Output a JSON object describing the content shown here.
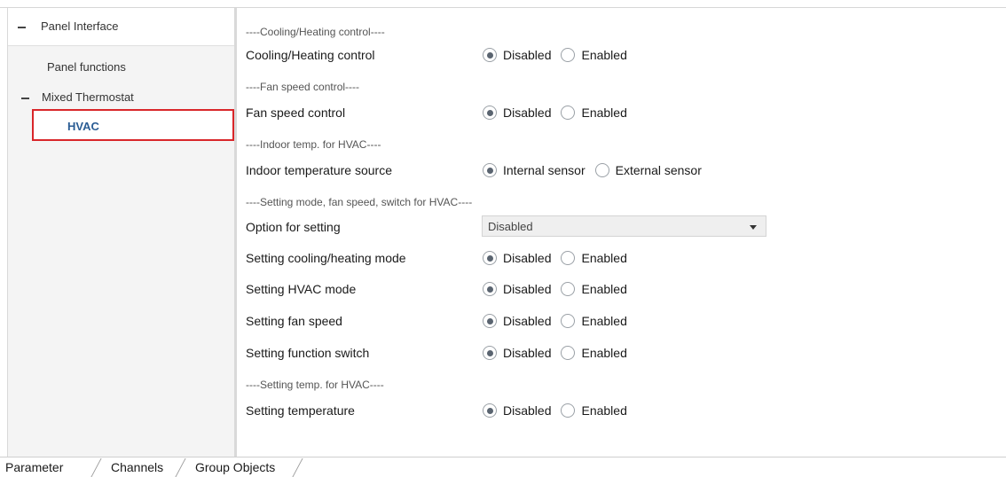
{
  "tree": {
    "root": {
      "label": "Panel Interface",
      "expanded": true
    },
    "items": [
      {
        "label": "Panel functions"
      },
      {
        "label": "Mixed Thermostat",
        "expanded": true
      },
      {
        "label": "HVAC",
        "selected": true
      }
    ]
  },
  "main": {
    "sections": {
      "cooling_heating": "----Cooling/Heating control----",
      "fan_speed": "----Fan speed control----",
      "indoor_temp": "----Indoor temp. for HVAC----",
      "setting_mode": "----Setting mode, fan speed, switch for HVAC----",
      "setting_temp": "----Setting temp. for HVAC----"
    },
    "params": {
      "cooling_heating_control": {
        "label": "Cooling/Heating control",
        "option1": "Disabled",
        "option2": "Enabled",
        "selected": "Disabled"
      },
      "fan_speed_control": {
        "label": "Fan speed control",
        "option1": "Disabled",
        "option2": "Enabled",
        "selected": "Disabled"
      },
      "indoor_temperature_source": {
        "label": "Indoor temperature source",
        "option1": "Internal sensor",
        "option2": "External sensor",
        "selected": "Internal sensor"
      },
      "option_for_setting": {
        "label": "Option for setting",
        "value": "Disabled"
      },
      "setting_cooling_heating_mode": {
        "label": "Setting cooling/heating mode",
        "option1": "Disabled",
        "option2": "Enabled",
        "selected": "Disabled"
      },
      "setting_hvac_mode": {
        "label": "Setting HVAC mode",
        "option1": "Disabled",
        "option2": "Enabled",
        "selected": "Disabled"
      },
      "setting_fan_speed": {
        "label": "Setting fan speed",
        "option1": "Disabled",
        "option2": "Enabled",
        "selected": "Disabled"
      },
      "setting_function_switch": {
        "label": "Setting function switch",
        "option1": "Disabled",
        "option2": "Enabled",
        "selected": "Disabled"
      },
      "setting_temperature": {
        "label": "Setting temperature",
        "option1": "Disabled",
        "option2": "Enabled",
        "selected": "Disabled"
      }
    }
  },
  "tabs": [
    "Parameter",
    "Channels",
    "Group Objects"
  ],
  "active_tab": "Parameter",
  "colors": {
    "selection_border": "#d9262a",
    "selected_text": "#2a5c94",
    "tree_bg": "#f4f4f4"
  }
}
